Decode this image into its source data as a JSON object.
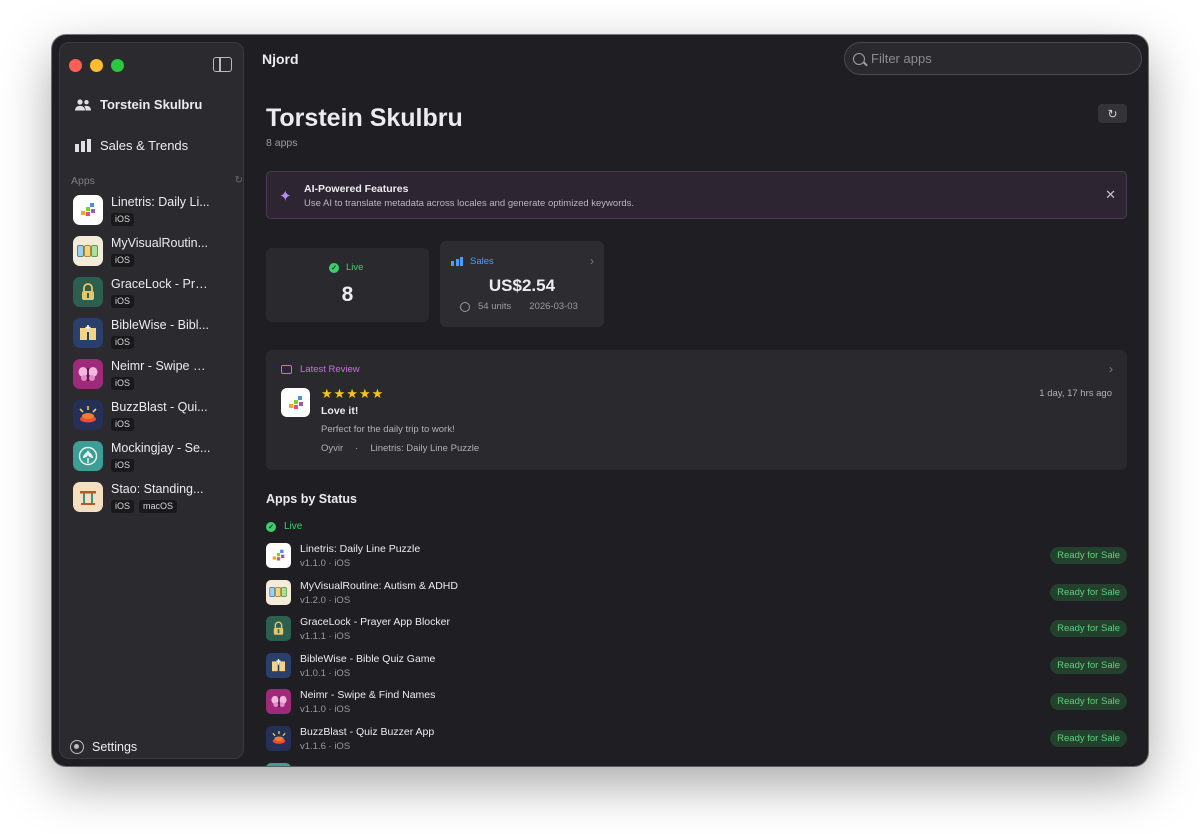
{
  "window": {
    "title": "Njord"
  },
  "sidebar": {
    "user_name": "Torstein Skulbru",
    "sales_label": "Sales & Trends",
    "apps_header": "Apps",
    "settings_label": "Settings",
    "apps": [
      {
        "name": "Linetris: Daily Li...",
        "tags": [
          "iOS"
        ],
        "icon": "puzzle-icon"
      },
      {
        "name": "MyVisualRoutin...",
        "tags": [
          "iOS"
        ],
        "icon": "routine-icon"
      },
      {
        "name": "GraceLock - Pra...",
        "tags": [
          "iOS"
        ],
        "icon": "lock-icon"
      },
      {
        "name": "BibleWise - Bibl...",
        "tags": [
          "iOS"
        ],
        "icon": "bible-icon"
      },
      {
        "name": "Neimr - Swipe &...",
        "tags": [
          "iOS"
        ],
        "icon": "butterfly-icon"
      },
      {
        "name": "BuzzBlast - Qui...",
        "tags": [
          "iOS"
        ],
        "icon": "buzzer-icon"
      },
      {
        "name": "Mockingjay - Se...",
        "tags": [
          "iOS"
        ],
        "icon": "bird-icon"
      },
      {
        "name": "Stao: Standing...",
        "tags": [
          "iOS",
          "macOS"
        ],
        "icon": "standing-desk-icon"
      }
    ]
  },
  "search": {
    "placeholder": "Filter apps"
  },
  "header": {
    "title": "Torstein Skulbru",
    "subtitle": "8 apps"
  },
  "ai_banner": {
    "title": "AI-Powered Features",
    "description": "Use AI to translate metadata across locales and generate optimized keywords."
  },
  "live_card": {
    "label": "Live",
    "value": "8"
  },
  "sales_card": {
    "label": "Sales",
    "value": "US$2.54",
    "units": "54 units",
    "date": "2026-03-03"
  },
  "review": {
    "label": "Latest Review",
    "stars": "★★★★★",
    "rating": 5,
    "title": "Love it!",
    "body": "Perfect for the daily trip to work!",
    "author": "Oyvir",
    "separator": "·",
    "app": "Linetris: Daily Line Puzzle",
    "time": "1 day, 17 hrs ago"
  },
  "status": {
    "title": "Apps by Status",
    "group_label": "Live",
    "badge_label": "Ready for Sale",
    "rows": [
      {
        "name": "Linetris: Daily Line Puzzle",
        "version": "v1.1.0 · iOS",
        "badge": "Ready for Sale"
      },
      {
        "name": "MyVisualRoutine: Autism & ADHD",
        "version": "v1.2.0 · iOS",
        "badge": "Ready for Sale"
      },
      {
        "name": "GraceLock - Prayer App Blocker",
        "version": "v1.1.1 · iOS",
        "badge": "Ready for Sale"
      },
      {
        "name": "BibleWise - Bible Quiz Game",
        "version": "v1.0.1 · iOS",
        "badge": "Ready for Sale"
      },
      {
        "name": "Neimr - Swipe & Find Names",
        "version": "v1.1.0 · iOS",
        "badge": "Ready for Sale"
      },
      {
        "name": "BuzzBlast - Quiz Buzzer App",
        "version": "v1.1.6 · iOS",
        "badge": "Ready for Sale"
      }
    ]
  },
  "colors": {
    "live_green": "#3ecf6b",
    "sales_blue": "#4d9bff",
    "review_purple": "#c86fe0",
    "ai_sparkle": "#b58cf0",
    "star_gold": "#f5c518"
  }
}
